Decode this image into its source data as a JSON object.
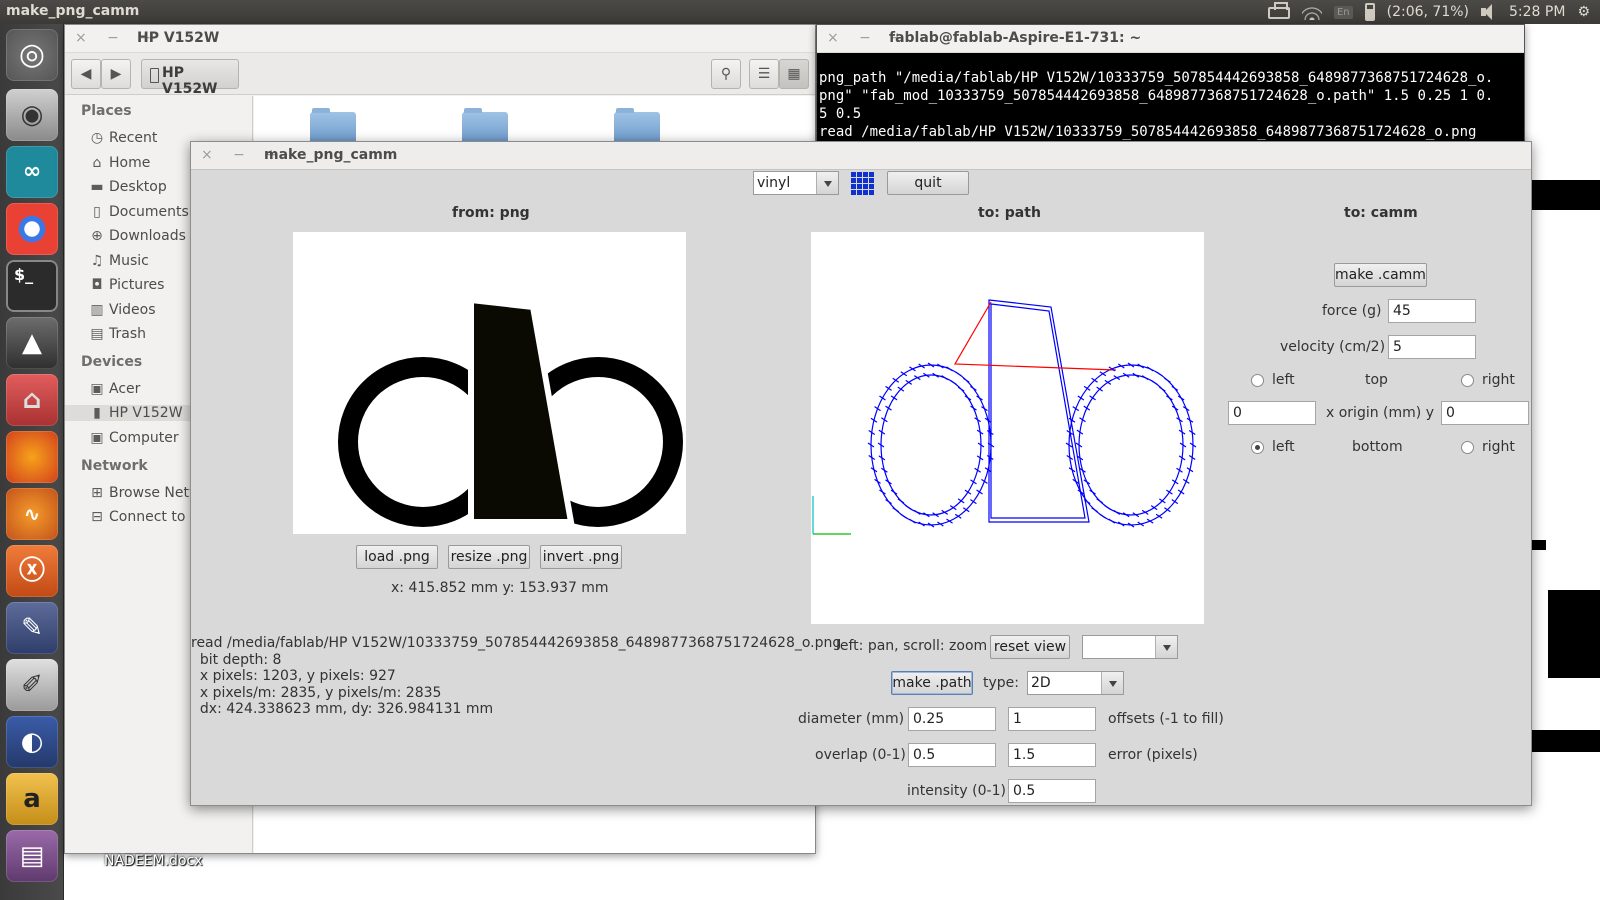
{
  "top_panel": {
    "app_name": "make_png_camm",
    "keyboard": "En",
    "battery": "(2:06, 71%)",
    "time": "5:28 PM"
  },
  "launcher": {
    "items": [
      "dash",
      "camera",
      "arduino",
      "chrome",
      "terminal",
      "inkscape",
      "files",
      "firefox",
      "audacity",
      "xampp",
      "text-editor",
      "drawing",
      "eclipse",
      "amazon",
      "software-center"
    ]
  },
  "files_window": {
    "title": "HP V152W",
    "path_button": "HP V152W",
    "sidebar": {
      "places_header": "Places",
      "places": [
        "Recent",
        "Home",
        "Desktop",
        "Documents",
        "Downloads",
        "Music",
        "Pictures",
        "Videos",
        "Trash"
      ],
      "devices_header": "Devices",
      "devices": [
        "Acer",
        "HP V152W",
        "Computer"
      ],
      "network_header": "Network",
      "network": [
        "Browse Netw",
        "Connect to S"
      ]
    }
  },
  "terminal": {
    "title": "fablab@fablab-Aspire-E1-731: ~",
    "lines": "png_path \"/media/fablab/HP V152W/10333759_507854442693858_6489877368751724628_o.\npng\" \"fab_mod_10333759_507854442693858_6489877368751724628_o.path\" 1.5 0.25 1 0.\n5 0.5\nread /media/fablab/HP V152W/10333759_507854442693858_6489877368751724628_o.png"
  },
  "desktop": {
    "file": "NADEEM.docx"
  },
  "app": {
    "title": "make_png_camm",
    "machine_select": "vinyl",
    "quit_label": "quit",
    "from_header": "from: png",
    "to_path_header": "to: path",
    "to_camm_header": "to: camm",
    "load_label": "load .png",
    "resize_label": "resize .png",
    "invert_label": "invert .png",
    "coords": "x: 415.852 mm  y: 153.937 mm",
    "info": "read /media/fablab/HP V152W/10333759_507854442693858_6489877368751724628_o.png\n  bit depth: 8\n  x pixels: 1203, y pixels: 927\n  x pixels/m: 2835, y pixels/m: 2835\n  dx: 424.338623 mm, dy: 326.984131 mm",
    "view_hint": "left: pan, scroll: zoom",
    "reset_view_label": "reset view",
    "view_select": "",
    "make_path_label": "make .path",
    "type_label": "type:",
    "type_value": "2D",
    "diameter_label": "diameter (mm)",
    "diameter_value": "0.25",
    "offsets_value": "1",
    "offsets_label": "offsets (-1 to fill)",
    "overlap_label": "overlap (0-1)",
    "overlap_value": "0.5",
    "error_value": "1.5",
    "error_label": "error (pixels)",
    "intensity_label": "intensity (0-1)",
    "intensity_value": "0.5",
    "make_camm_label": "make .camm",
    "force_label": "force (g)",
    "force_value": "45",
    "velocity_label": "velocity (cm/2)",
    "velocity_value": "5",
    "left_label": "left",
    "top_label": "top",
    "right_label": "right",
    "origin_x_value": "0",
    "origin_label": "x  origin (mm)  y",
    "origin_y_value": "0",
    "bottom_label": "bottom",
    "origin_selected": "bottom-left",
    "path_color": "#0000ff",
    "move_color": "#ff0000"
  }
}
